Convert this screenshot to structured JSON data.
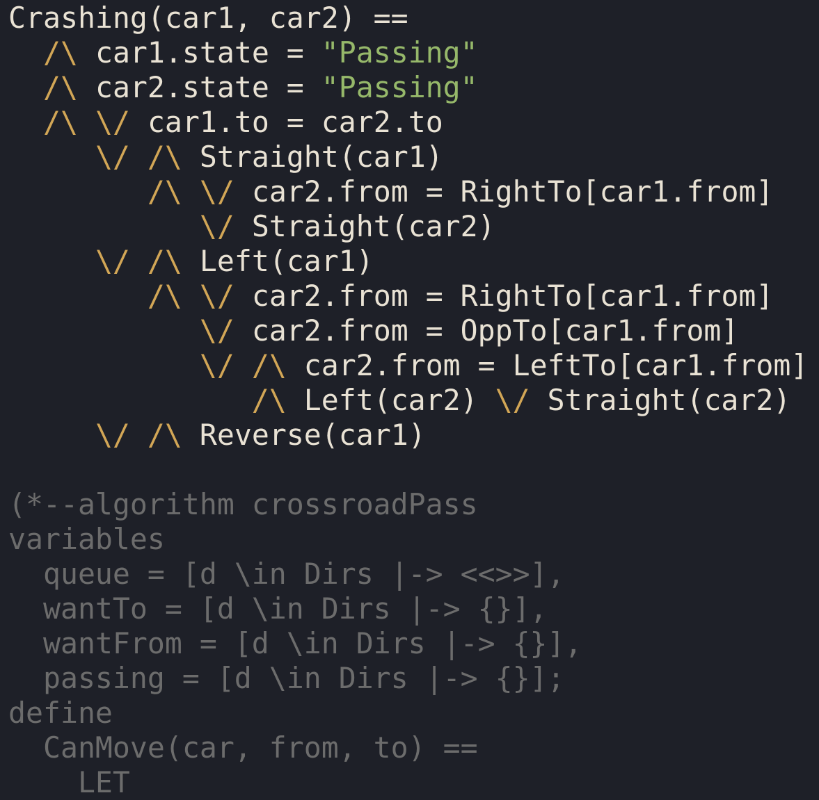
{
  "colors": {
    "background": "#1e2028",
    "text": "#e9e2d4",
    "operator": "#d2a656",
    "string": "#96b86a",
    "comment": "#6c6c6c"
  },
  "lines": [
    [
      [
        "t",
        "Crashing(car1, car2) =="
      ]
    ],
    [
      [
        "t",
        "  "
      ],
      [
        "o",
        "/\\"
      ],
      [
        "t",
        " car1.state = "
      ],
      [
        "s",
        "\"Passing\""
      ]
    ],
    [
      [
        "t",
        "  "
      ],
      [
        "o",
        "/\\"
      ],
      [
        "t",
        " car2.state = "
      ],
      [
        "s",
        "\"Passing\""
      ]
    ],
    [
      [
        "t",
        "  "
      ],
      [
        "o",
        "/\\"
      ],
      [
        "t",
        " "
      ],
      [
        "o",
        "\\/"
      ],
      [
        "t",
        " car1.to = car2.to"
      ]
    ],
    [
      [
        "t",
        "     "
      ],
      [
        "o",
        "\\/"
      ],
      [
        "t",
        " "
      ],
      [
        "o",
        "/\\"
      ],
      [
        "t",
        " Straight(car1)"
      ]
    ],
    [
      [
        "t",
        "        "
      ],
      [
        "o",
        "/\\"
      ],
      [
        "t",
        " "
      ],
      [
        "o",
        "\\/"
      ],
      [
        "t",
        " car2.from = RightTo[car1.from]"
      ]
    ],
    [
      [
        "t",
        "           "
      ],
      [
        "o",
        "\\/"
      ],
      [
        "t",
        " Straight(car2)"
      ]
    ],
    [
      [
        "t",
        "     "
      ],
      [
        "o",
        "\\/"
      ],
      [
        "t",
        " "
      ],
      [
        "o",
        "/\\"
      ],
      [
        "t",
        " Left(car1)"
      ]
    ],
    [
      [
        "t",
        "        "
      ],
      [
        "o",
        "/\\"
      ],
      [
        "t",
        " "
      ],
      [
        "o",
        "\\/"
      ],
      [
        "t",
        " car2.from = RightTo[car1.from]"
      ]
    ],
    [
      [
        "t",
        "           "
      ],
      [
        "o",
        "\\/"
      ],
      [
        "t",
        " car2.from = OppTo[car1.from]"
      ]
    ],
    [
      [
        "t",
        "           "
      ],
      [
        "o",
        "\\/"
      ],
      [
        "t",
        " "
      ],
      [
        "o",
        "/\\"
      ],
      [
        "t",
        " car2.from = LeftTo[car1.from]"
      ]
    ],
    [
      [
        "t",
        "              "
      ],
      [
        "o",
        "/\\"
      ],
      [
        "t",
        " Left(car2) "
      ],
      [
        "o",
        "\\/"
      ],
      [
        "t",
        " Straight(car2)"
      ]
    ],
    [
      [
        "t",
        "     "
      ],
      [
        "o",
        "\\/"
      ],
      [
        "t",
        " "
      ],
      [
        "o",
        "/\\"
      ],
      [
        "t",
        " Reverse(car1)"
      ]
    ],
    [
      [
        "t",
        ""
      ]
    ],
    [
      [
        "c",
        "(*--algorithm crossroadPass"
      ]
    ],
    [
      [
        "c",
        "variables"
      ]
    ],
    [
      [
        "c",
        "  queue = [d \\in Dirs |-> <<>>],"
      ]
    ],
    [
      [
        "c",
        "  wantTo = [d \\in Dirs |-> {}],"
      ]
    ],
    [
      [
        "c",
        "  wantFrom = [d \\in Dirs |-> {}],"
      ]
    ],
    [
      [
        "c",
        "  passing = [d \\in Dirs |-> {}];"
      ]
    ],
    [
      [
        "c",
        "define"
      ]
    ],
    [
      [
        "c",
        "  CanMove(car, from, to) =="
      ]
    ],
    [
      [
        "c",
        "    LET"
      ]
    ]
  ]
}
